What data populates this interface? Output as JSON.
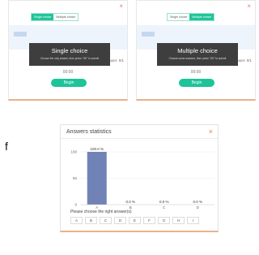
{
  "single_panel": {
    "close_glyph": "×",
    "toggle": [
      "Single choice",
      "Multiple choice"
    ],
    "active_index": 0,
    "modal_title": "Single choice",
    "modal_desc": "Choose the only answer, then press \"OK\" to submit",
    "user_count": "user: 0/1",
    "timer": "00:00",
    "begin": "Begin"
  },
  "multiple_panel": {
    "close_glyph": "×",
    "toggle": [
      "Single choice",
      "Multiple choice"
    ],
    "active_index": 1,
    "modal_title": "Multiple choice",
    "modal_desc": "Choose some answers, then press \"OK\" to submit",
    "user_count": "user: 0/1",
    "timer": "00:00",
    "begin": "Begin"
  },
  "side_letter": "f",
  "stats": {
    "title": "Answers statistics",
    "close_glyph": "×",
    "prompt": "Please choose the right answer(s)",
    "letters": [
      "A",
      "B",
      "C",
      "D",
      "E",
      "F",
      "G",
      "H",
      "I"
    ]
  },
  "chart_data": {
    "type": "bar",
    "categories": [
      "A",
      "B",
      "C",
      "D"
    ],
    "values": [
      100,
      0,
      0,
      0
    ],
    "data_labels": [
      "100.0 %",
      "0.0 %",
      "0.0 %",
      "0.0 %"
    ],
    "y_ticks": [
      0,
      50,
      100
    ],
    "ylim": [
      0,
      100
    ],
    "grid": true,
    "bar_color": "#7183b6"
  },
  "colors": {
    "accent_green": "#1ec39a",
    "close_red": "#e2796a",
    "modal_bg": "#3e3e3e"
  }
}
